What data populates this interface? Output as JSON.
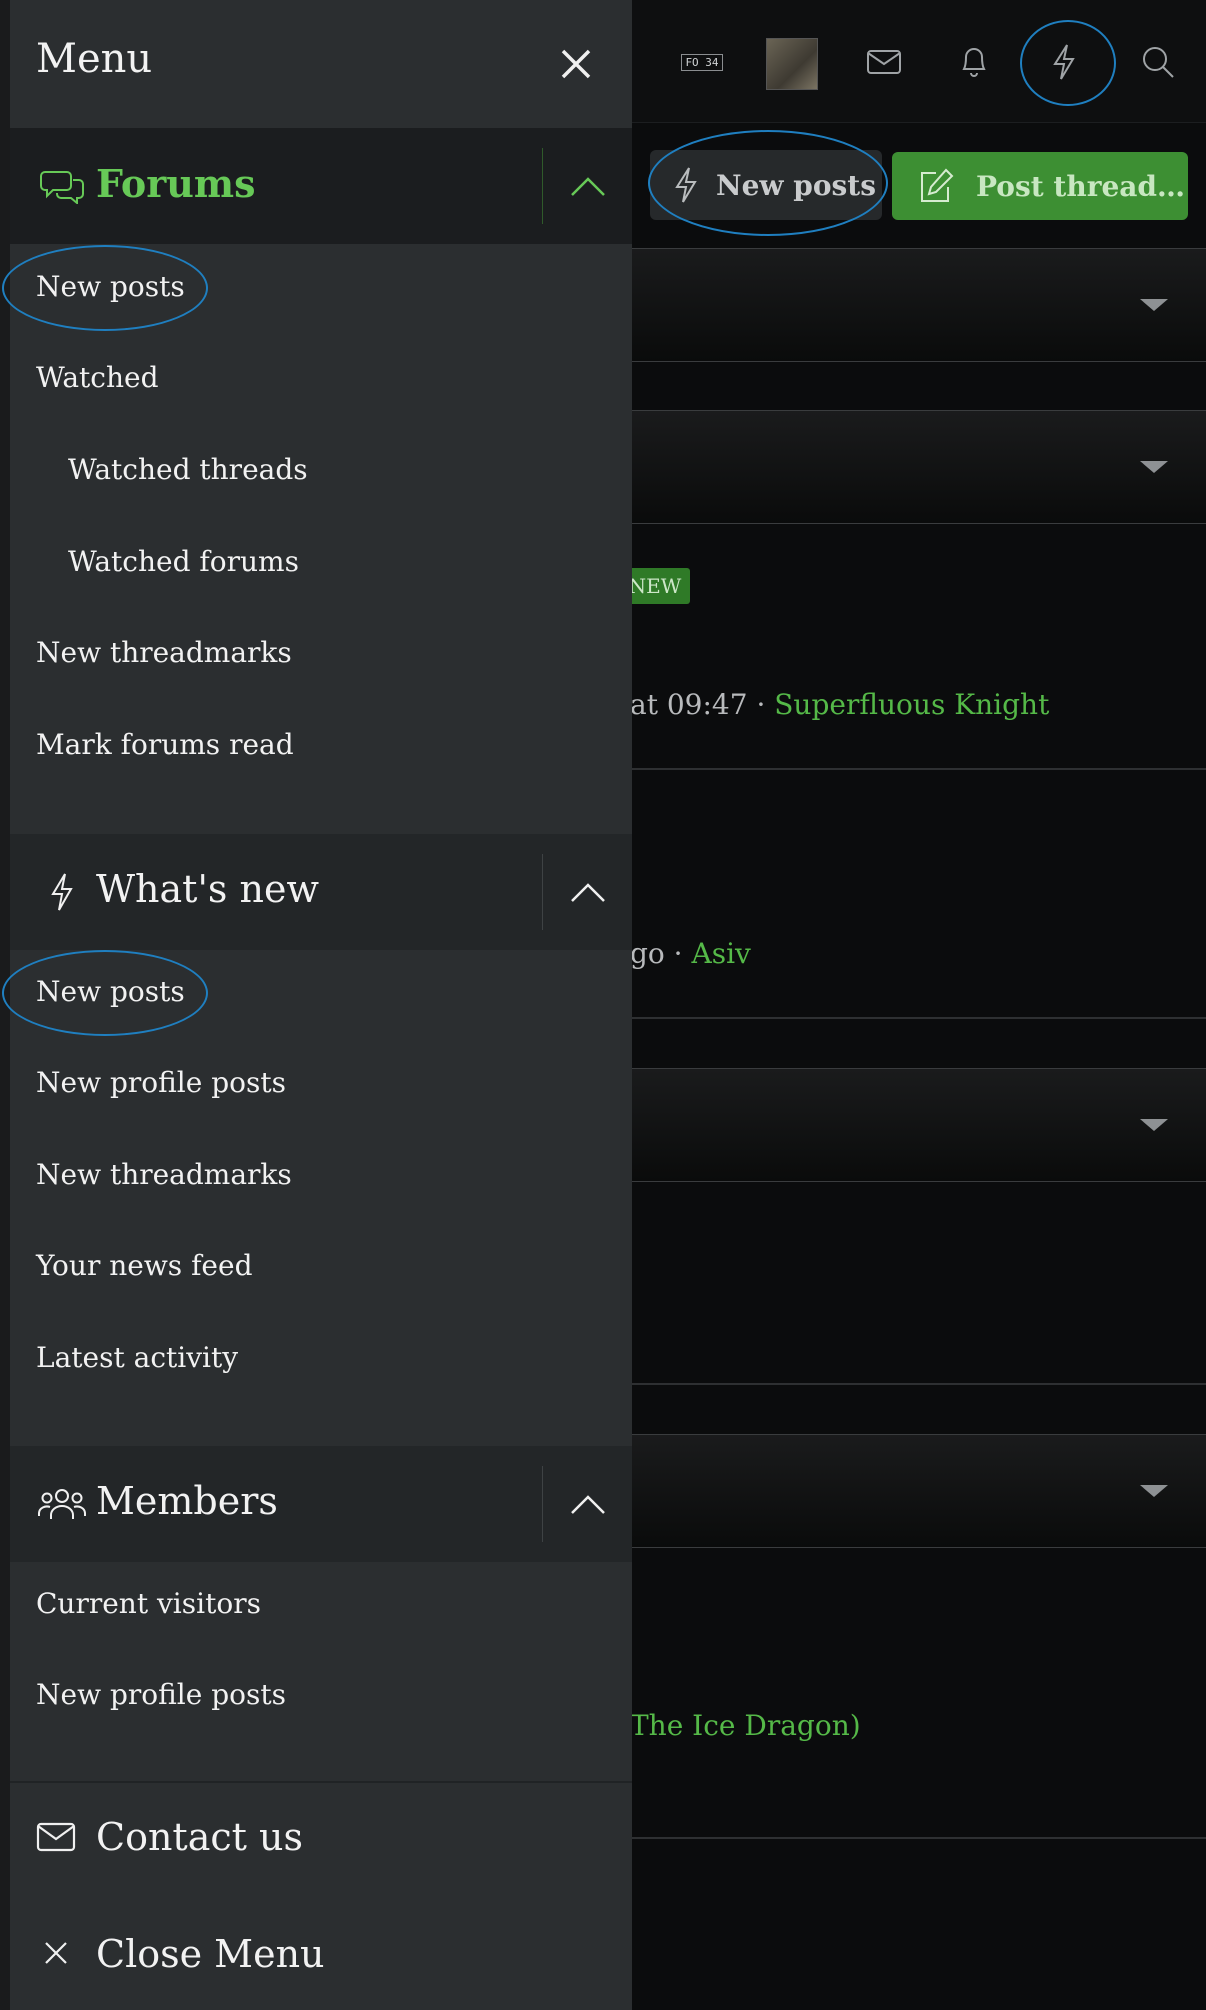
{
  "header": {
    "user_badge": "FO 34",
    "icons": [
      "conversations-icon",
      "alerts-icon",
      "whats-new-icon",
      "search-icon"
    ]
  },
  "toolbar": {
    "new_posts_label": "New posts",
    "post_thread_label": "Post thread…"
  },
  "background": {
    "new_badge": "NEW",
    "line1_meta": "at 09:47 · ",
    "line1_user": "Superfluous Knight",
    "line2_meta": "go · ",
    "line2_user": "Asiv",
    "line3_link": "The Ice Dragon)"
  },
  "menu": {
    "title": "Menu",
    "sections": [
      {
        "label": "Forums",
        "items": [
          "New posts",
          "Watched",
          "Watched threads",
          "Watched forums",
          "New threadmarks",
          "Mark forums read"
        ]
      },
      {
        "label": "What's new",
        "items": [
          "New posts",
          "New profile posts",
          "New threadmarks",
          "Your news feed",
          "Latest activity"
        ]
      },
      {
        "label": "Members",
        "items": [
          "Current visitors",
          "New profile posts"
        ]
      }
    ],
    "contact_label": "Contact us",
    "close_label": "Close Menu"
  },
  "colors": {
    "accent_green": "#67c957",
    "button_green": "#3d8f33",
    "annotation_blue": "#1f7fc0",
    "menu_bg": "#2b2e30"
  }
}
